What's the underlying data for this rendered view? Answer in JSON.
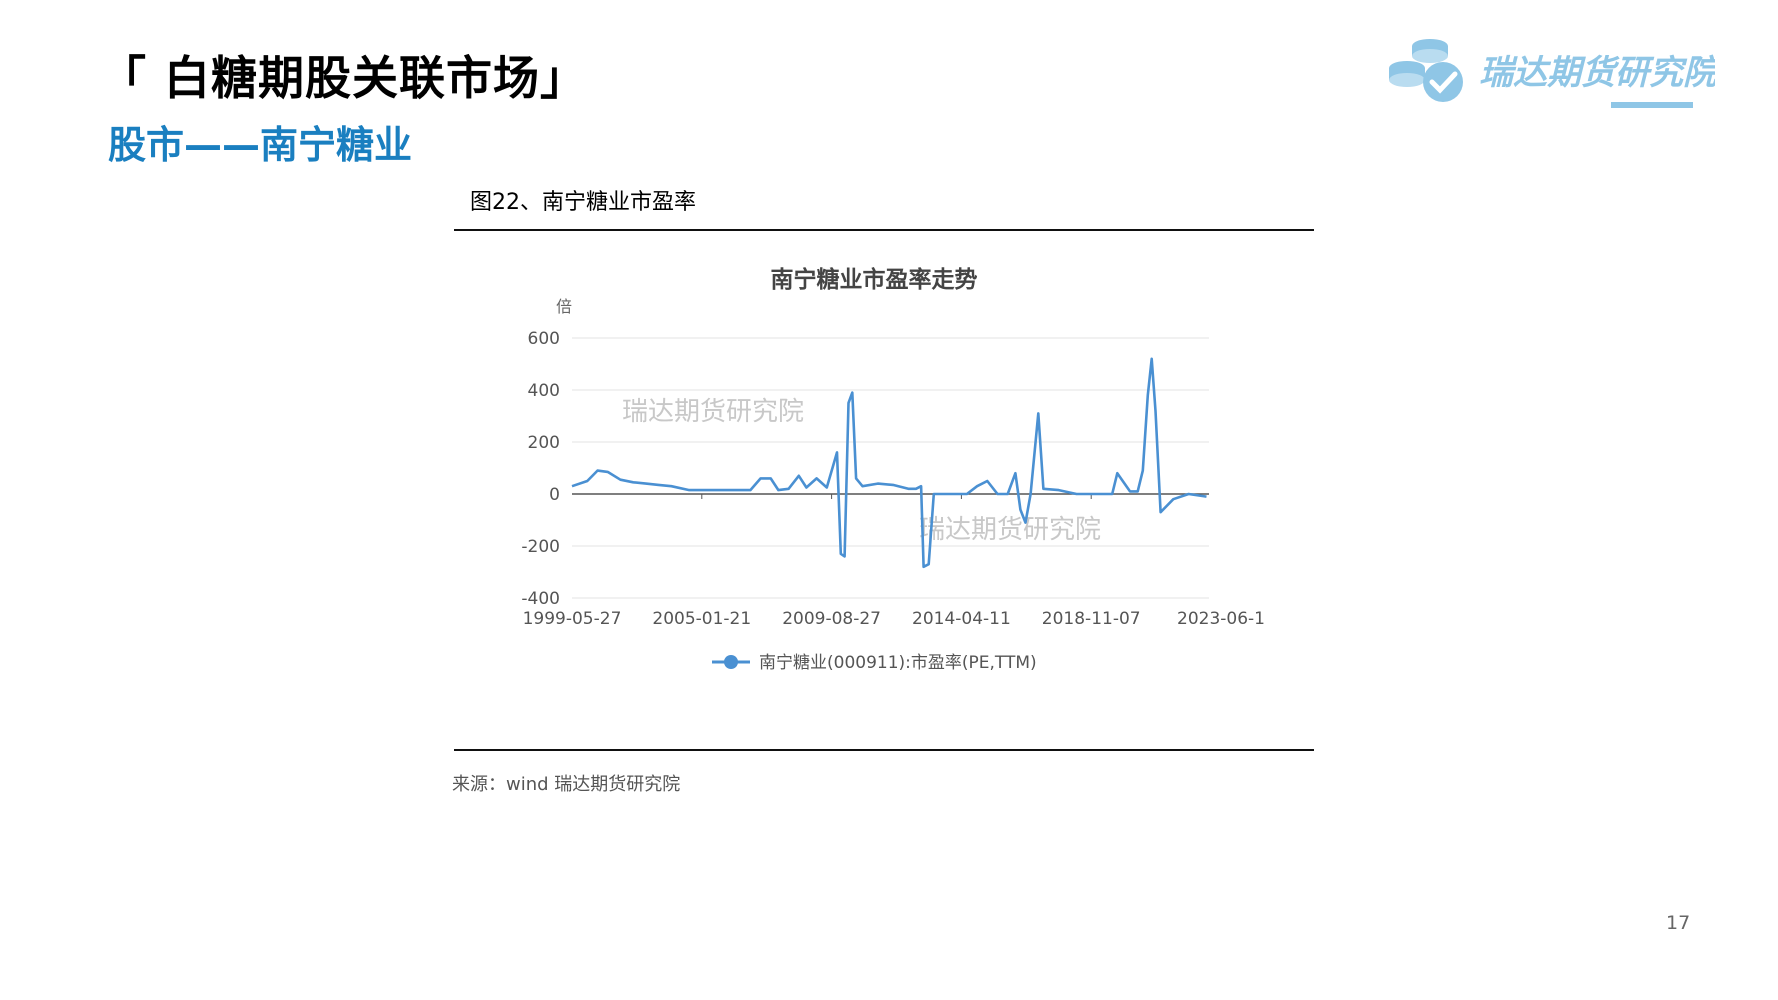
{
  "header": {
    "title": "「 白糖期股关联市场」",
    "subtitle": "股市——南宁糖业",
    "logo_text": "瑞达期货研究院"
  },
  "figure": {
    "caption": "图22、南宁糖业市盈率",
    "source": "来源：wind   瑞达期货研究院"
  },
  "page_number": "17",
  "colors": {
    "accent": "#1a7fc0",
    "series": "#4a90d2",
    "logo": "#8fc6e6"
  },
  "chart_data": {
    "type": "line",
    "title": "南宁糖业市盈率走势",
    "ylabel": "倍",
    "xlabel": "",
    "ylim": [
      -400,
      600
    ],
    "yticks": [
      600,
      400,
      200,
      0,
      -200,
      -400
    ],
    "xticks": [
      "1999-05-27",
      "2005-01-21",
      "2009-08-27",
      "2014-04-11",
      "2018-11-07",
      "2023-06-1"
    ],
    "xlim": [
      1999.4,
      2024.4
    ],
    "grid": true,
    "legend_position": "bottom",
    "watermarks": [
      "瑞达期货研究院",
      "瑞达期货研究院"
    ],
    "series": [
      {
        "name": "南宁糖业(000911):市盈率(PE,TTM)",
        "color": "#4a90d2",
        "x": [
          1999.4,
          2000.0,
          2000.4,
          2000.8,
          2001.3,
          2001.8,
          2002.3,
          2002.8,
          2003.3,
          2004.0,
          2004.6,
          2005.2,
          2005.8,
          2006.4,
          2006.8,
          2007.2,
          2007.5,
          2007.9,
          2008.3,
          2008.6,
          2009.0,
          2009.4,
          2009.8,
          2009.95,
          2010.1,
          2010.25,
          2010.4,
          2010.55,
          2010.8,
          2011.4,
          2012.0,
          2012.6,
          2012.9,
          2013.1,
          2013.2,
          2013.4,
          2013.6,
          2013.9,
          2014.4,
          2014.9,
          2015.3,
          2015.7,
          2016.1,
          2016.5,
          2016.8,
          2017.0,
          2017.2,
          2017.4,
          2017.7,
          2017.9,
          2018.5,
          2019.2,
          2020.0,
          2020.6,
          2020.8,
          2021.3,
          2021.6,
          2021.8,
          2022.0,
          2022.15,
          2022.3,
          2022.5,
          2023.0,
          2023.6,
          2024.3
        ],
        "y": [
          30,
          50,
          90,
          85,
          55,
          45,
          40,
          35,
          30,
          15,
          15,
          15,
          15,
          15,
          60,
          60,
          15,
          20,
          70,
          25,
          60,
          25,
          160,
          -230,
          -240,
          350,
          390,
          60,
          30,
          40,
          35,
          20,
          20,
          30,
          -280,
          -270,
          0,
          0,
          0,
          0,
          30,
          50,
          0,
          0,
          80,
          -60,
          -110,
          0,
          310,
          20,
          15,
          0,
          0,
          0,
          80,
          10,
          10,
          90,
          380,
          520,
          320,
          -70,
          -20,
          0,
          -10
        ]
      }
    ]
  }
}
